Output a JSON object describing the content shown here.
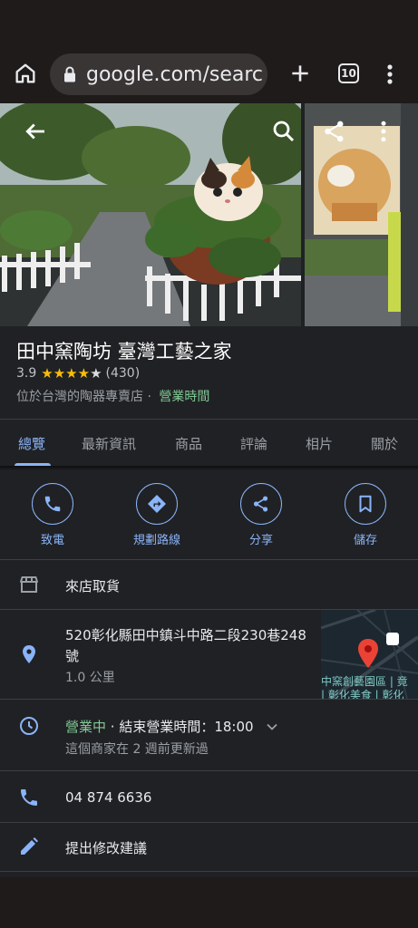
{
  "browser": {
    "url": "google.com/searc",
    "tab_count": "10"
  },
  "place": {
    "title": "田中窯陶坊 臺灣工藝之家",
    "rating": "3.9",
    "stars_filled": 4,
    "stars_total": 5,
    "review_count": "(430)",
    "category": "位於台灣的陶器專賣店 ·",
    "hours_link": "營業時間"
  },
  "tabs": [
    "總覽",
    "最新資訊",
    "商品",
    "評論",
    "相片",
    "關於"
  ],
  "actions": [
    {
      "label": "致電",
      "icon": "phone-icon"
    },
    {
      "label": "規劃路線",
      "icon": "directions-icon"
    },
    {
      "label": "分享",
      "icon": "share-icon"
    },
    {
      "label": "儲存",
      "icon": "bookmark-icon"
    }
  ],
  "info": {
    "pickup": "來店取貨",
    "address_line1": "520彰化縣田中鎮斗中路二段230巷248",
    "address_line2": "號",
    "distance": "1.0 公里",
    "open_status": "營業中",
    "closing": " · 結束營業時間：18:00",
    "updated": "這個商家在 2 週前更新過",
    "phone": "04 874 6636",
    "suggest_edit": "提出修改建議"
  },
  "map": {
    "label1": "中窯創藝園區 | 竟",
    "label2": "| 彰化美食 | 彰化"
  },
  "colors": {
    "accent_blue": "#8ab4f8",
    "open_green": "#81c995",
    "star_yellow": "#fbbc04",
    "background": "#202124"
  }
}
